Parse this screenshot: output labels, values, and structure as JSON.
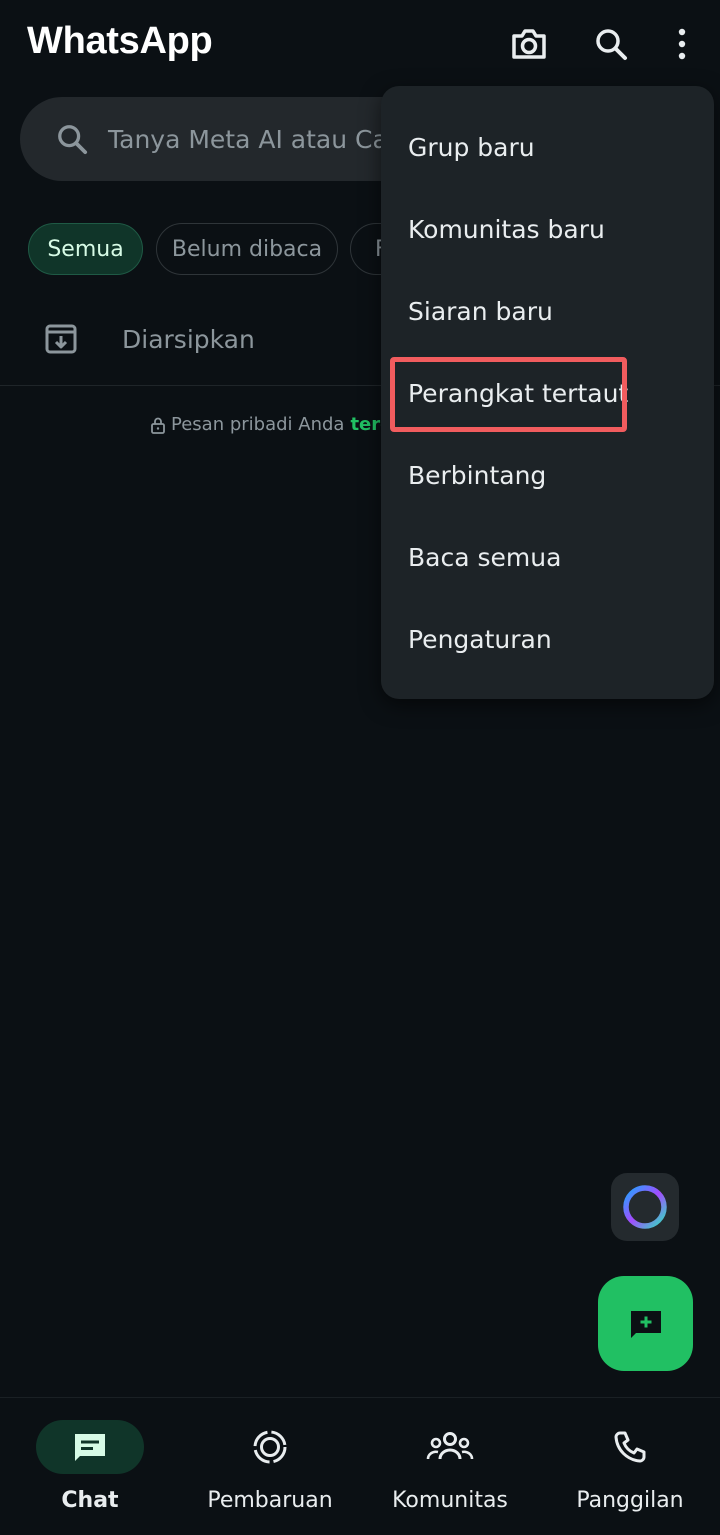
{
  "header": {
    "title": "WhatsApp",
    "camera_icon": "camera-icon",
    "search_icon": "search-icon",
    "more_icon": "more-vertical-icon"
  },
  "search": {
    "placeholder": "Tanya Meta AI atau Car"
  },
  "filters": [
    {
      "label": "Semua",
      "active": true
    },
    {
      "label": "Belum dibaca",
      "active": false
    },
    {
      "label": "F",
      "active": false
    }
  ],
  "archived": {
    "label": "Diarsipkan"
  },
  "encryption_notice": {
    "text": "Pesan pribadi Anda",
    "link": "terenl"
  },
  "menu": {
    "items": [
      "Grup baru",
      "Komunitas baru",
      "Siaran baru",
      "Perangkat tertaut",
      "Berbintang",
      "Baca semua",
      "Pengaturan"
    ]
  },
  "bottom_nav": {
    "items": [
      {
        "label": "Chat",
        "icon": "chat-icon",
        "active": true
      },
      {
        "label": "Pembaruan",
        "icon": "updates-icon",
        "active": false
      },
      {
        "label": "Komunitas",
        "icon": "communities-icon",
        "active": false
      },
      {
        "label": "Panggilan",
        "icon": "phone-icon",
        "active": false
      }
    ]
  },
  "colors": {
    "background": "#0b1014",
    "accent": "#21c063",
    "menu_bg": "#1d2327",
    "highlight": "#f15c5e"
  }
}
